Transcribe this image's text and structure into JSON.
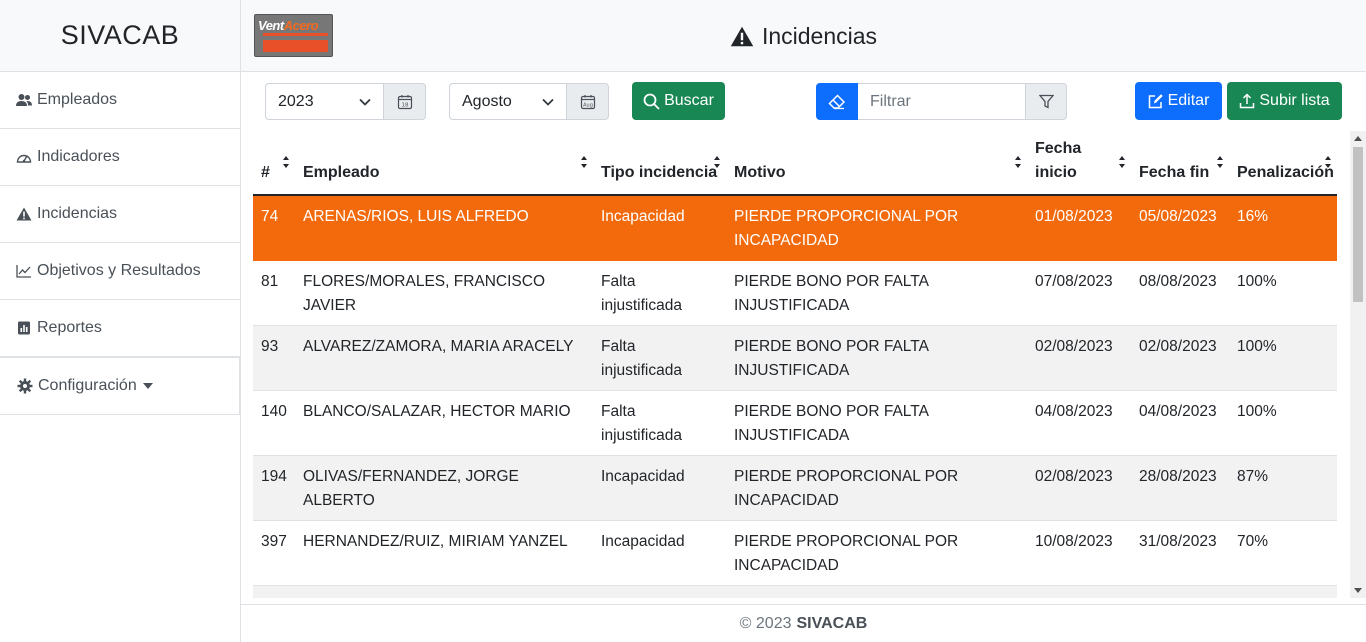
{
  "app": {
    "brand": "SIVACAB",
    "logo_text_1": "Vent",
    "logo_text_2": "Acero"
  },
  "sidebar": {
    "items": [
      {
        "label": "Empleados",
        "icon": "users-icon"
      },
      {
        "label": "Indicadores",
        "icon": "gauge-icon"
      },
      {
        "label": "Incidencias",
        "icon": "warning-icon"
      },
      {
        "label": "Objetivos y Resultados",
        "icon": "line-chart-icon"
      },
      {
        "label": "Reportes",
        "icon": "report-icon"
      },
      {
        "label": "Configuración",
        "icon": "gear-icon"
      }
    ]
  },
  "header": {
    "title": "Incidencias"
  },
  "toolbar": {
    "year": "2023",
    "month": "Agosto",
    "search_label": "Buscar",
    "filter_placeholder": "Filtrar",
    "edit_label": "Editar",
    "upload_label": "Subir lista"
  },
  "table": {
    "columns": [
      "#",
      "Empleado",
      "Tipo incidencia",
      "Motivo",
      "Fecha inicio",
      "Fecha fin",
      "Penalización"
    ],
    "rows": [
      {
        "num": "74",
        "empleado": "ARENAS/RIOS, LUIS ALFREDO",
        "tipo": "Incapacidad",
        "motivo": "PIERDE PROPORCIONAL POR INCAPACIDAD",
        "inicio": "01/08/2023",
        "fin": "05/08/2023",
        "pen": "16%"
      },
      {
        "num": "81",
        "empleado": "FLORES/MORALES, FRANCISCO JAVIER",
        "tipo": "Falta injustificada",
        "motivo": "PIERDE BONO POR FALTA INJUSTIFICADA",
        "inicio": "07/08/2023",
        "fin": "08/08/2023",
        "pen": "100%"
      },
      {
        "num": "93",
        "empleado": "ALVAREZ/ZAMORA, MARIA ARACELY",
        "tipo": "Falta injustificada",
        "motivo": "PIERDE BONO POR FALTA INJUSTIFICADA",
        "inicio": "02/08/2023",
        "fin": "02/08/2023",
        "pen": "100%"
      },
      {
        "num": "140",
        "empleado": "BLANCO/SALAZAR, HECTOR MARIO",
        "tipo": "Falta injustificada",
        "motivo": "PIERDE BONO POR FALTA INJUSTIFICADA",
        "inicio": "04/08/2023",
        "fin": "04/08/2023",
        "pen": "100%"
      },
      {
        "num": "194",
        "empleado": "OLIVAS/FERNANDEZ, JORGE ALBERTO",
        "tipo": "Incapacidad",
        "motivo": "PIERDE PROPORCIONAL POR INCAPACIDAD",
        "inicio": "02/08/2023",
        "fin": "28/08/2023",
        "pen": "87%"
      },
      {
        "num": "397",
        "empleado": "HERNANDEZ/RUIZ, MIRIAM YANZEL",
        "tipo": "Incapacidad",
        "motivo": "PIERDE PROPORCIONAL POR INCAPACIDAD",
        "inicio": "10/08/2023",
        "fin": "31/08/2023",
        "pen": "70%"
      }
    ]
  },
  "footer": {
    "copyright": "© 2023",
    "brand": "SIVACAB"
  },
  "colors": {
    "selected_row": "#f26a0c",
    "primary": "#0d6efd",
    "success": "#198754"
  }
}
